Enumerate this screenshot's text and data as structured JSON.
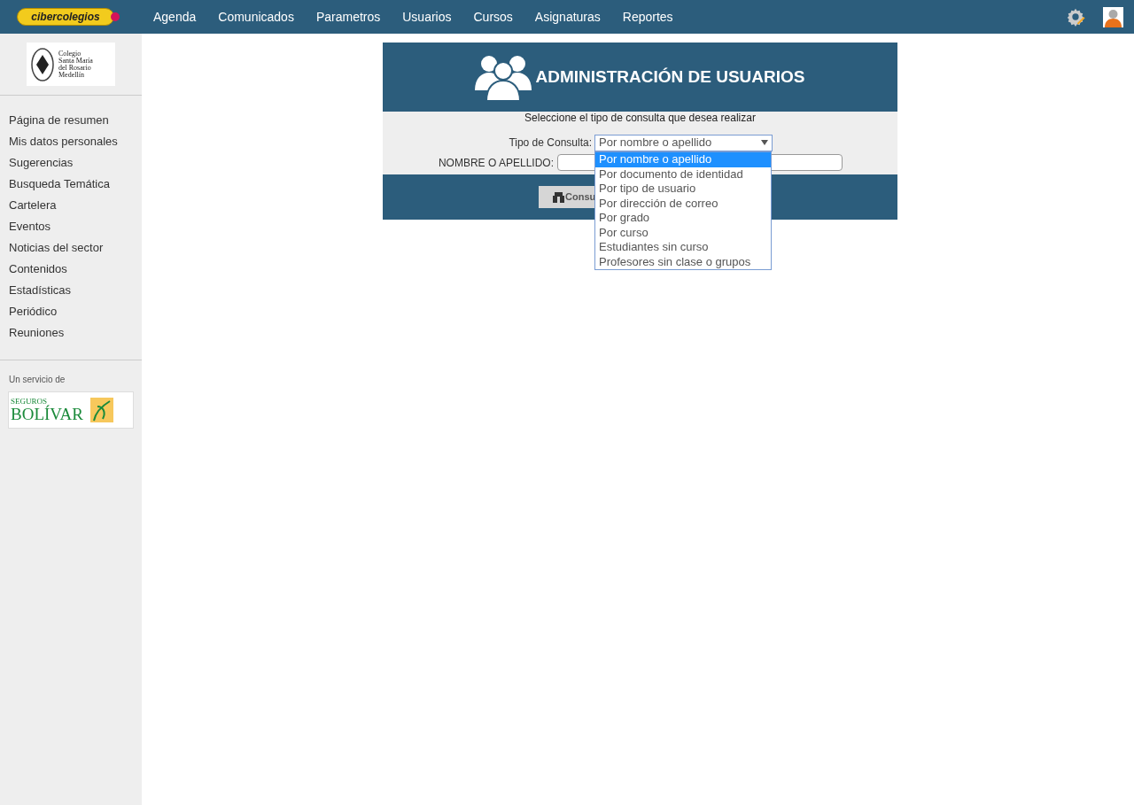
{
  "topbar": {
    "logo": "cibercolegios",
    "nav": [
      "Agenda",
      "Comunicados",
      "Parametros",
      "Usuarios",
      "Cursos",
      "Asignaturas",
      "Reportes"
    ]
  },
  "sidebar": {
    "school_logo": [
      "Colegio",
      "Santa María",
      "del Rosario",
      "Medellín"
    ],
    "items": [
      "Página de resumen",
      "Mis datos personales",
      "Sugerencias",
      "Busqueda Temática",
      "Cartelera",
      "Eventos",
      "Noticias del sector",
      "Contenidos",
      "Estadísticas",
      "Periódico",
      "Reuniones"
    ],
    "service_label": "Un servicio de",
    "sponsor": {
      "line1": "SEGUROS",
      "line2": "BOLÍVAR"
    }
  },
  "panel": {
    "title": "ADMINISTRACIÓN DE USUARIOS",
    "instruction": "Seleccione el tipo de consulta que desea realizar",
    "type_label": "Tipo de Consulta:",
    "type_value": "Por nombre o apellido",
    "name_label": "NOMBRE O APELLIDO:",
    "button": "Consu",
    "options": [
      {
        "label": "Por nombre o apellido",
        "selected": true
      },
      {
        "label": "Por documento de identidad",
        "selected": false
      },
      {
        "label": "Por tipo de usuario",
        "selected": false
      },
      {
        "label": "Por dirección de correo",
        "selected": false
      },
      {
        "label": "Por grado",
        "selected": false
      },
      {
        "label": "Por curso",
        "selected": false
      },
      {
        "label": "Estudiantes sin curso",
        "selected": false
      },
      {
        "label": "Profesores sin clase o grupos",
        "selected": false
      }
    ]
  }
}
